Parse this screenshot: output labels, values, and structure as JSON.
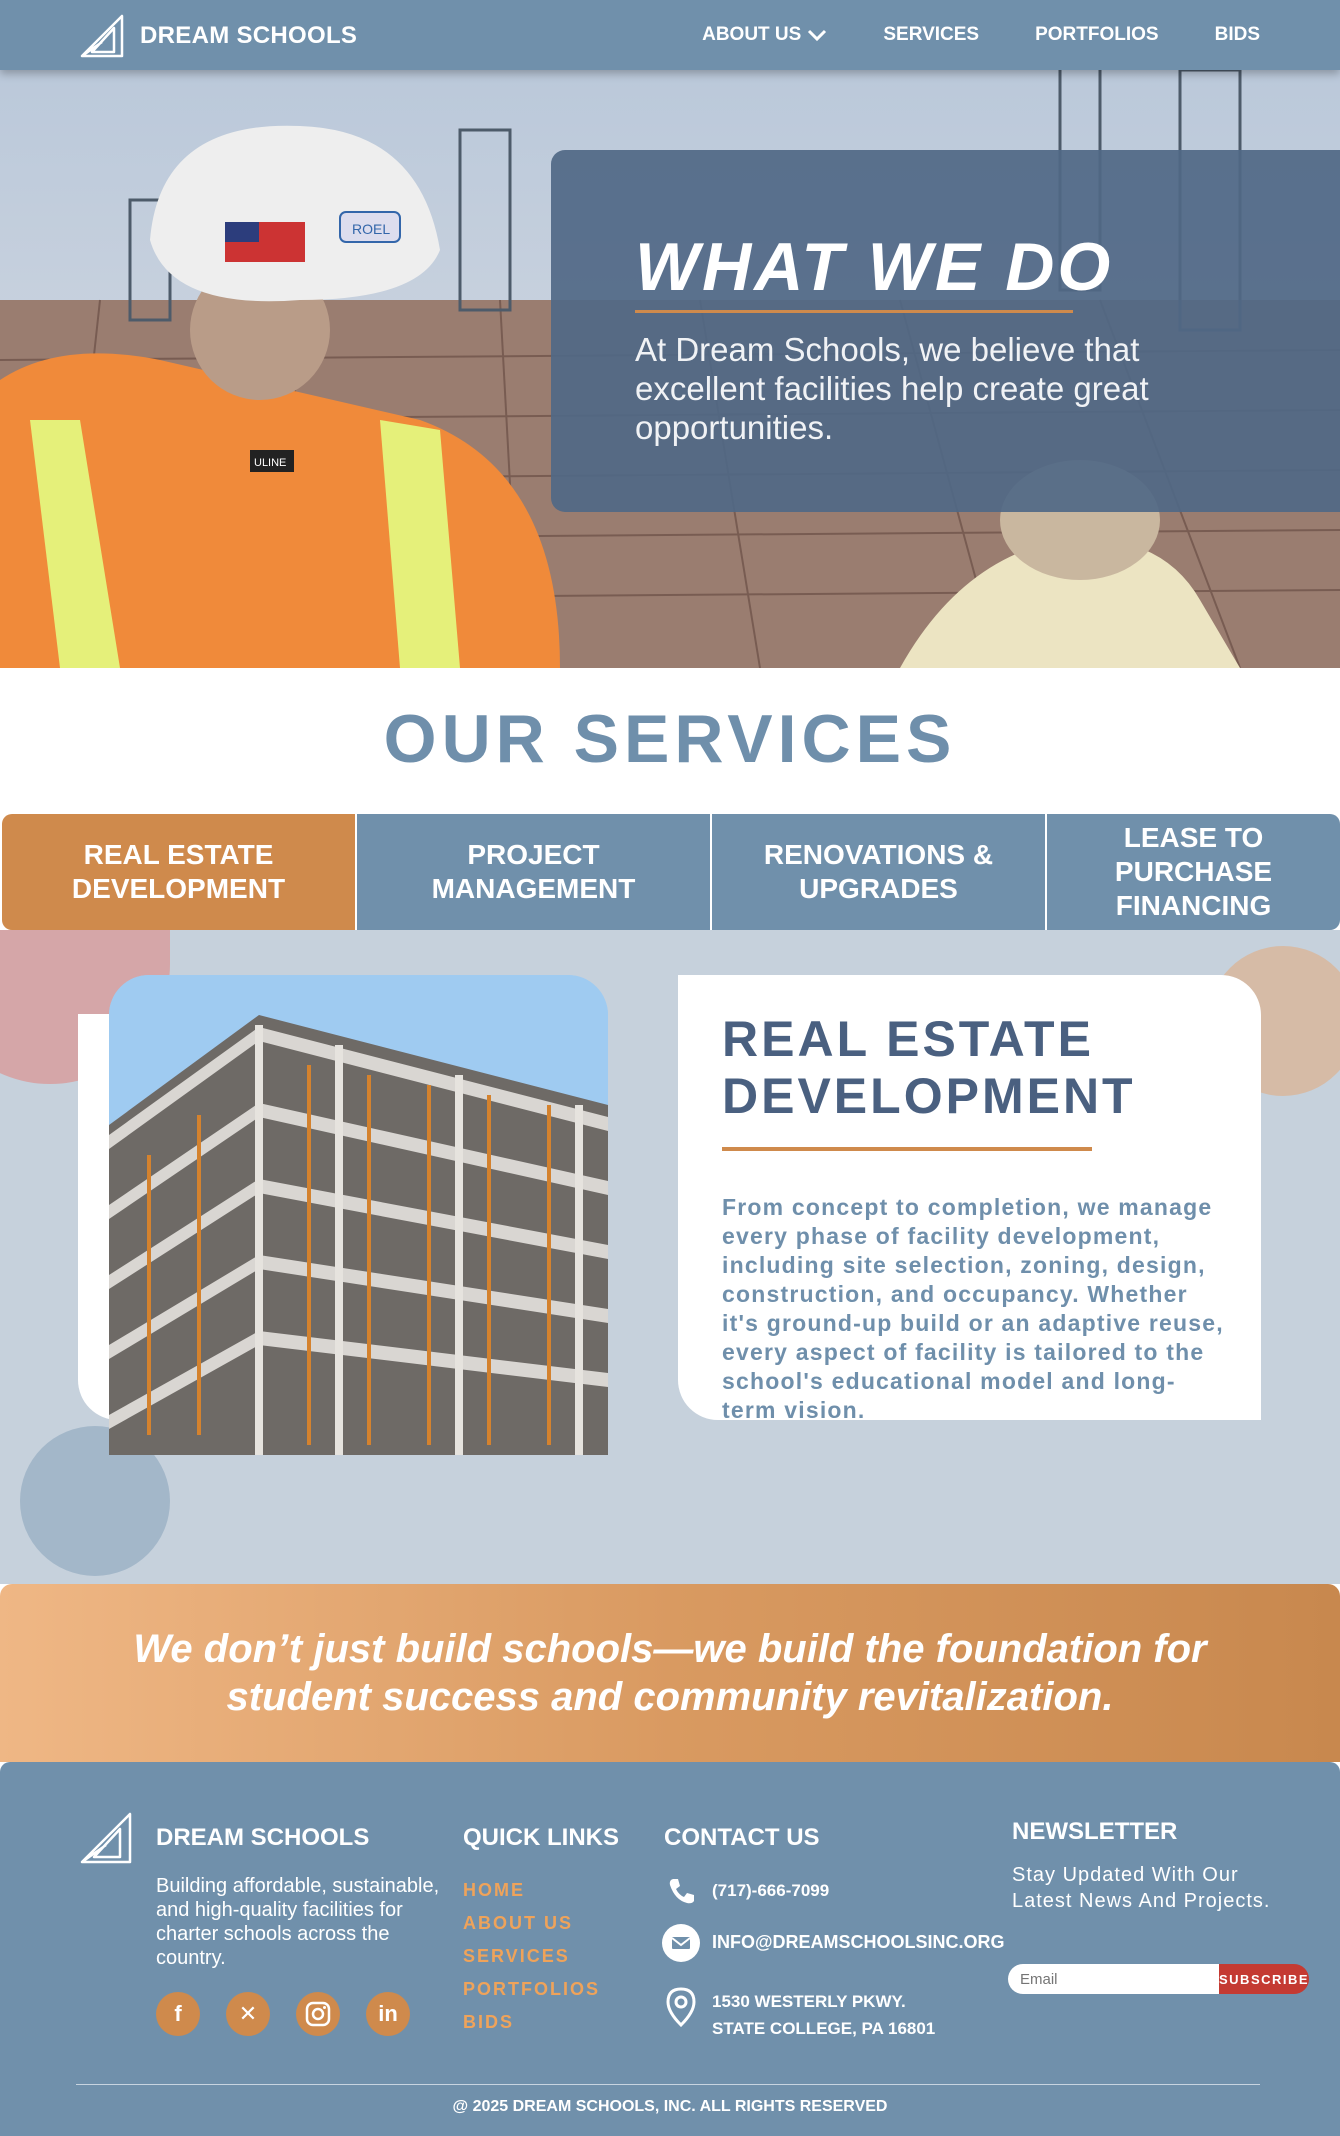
{
  "nav": {
    "brand": "DREAM SCHOOLS",
    "items": [
      {
        "label": "ABOUT US"
      },
      {
        "label": "SERVICES"
      },
      {
        "label": "PORTFOLIOS"
      },
      {
        "label": "BIDS"
      }
    ]
  },
  "hero": {
    "title": "WHAT WE DO",
    "text": "At Dream Schools, we believe that excellent facilities help create great opportunities.",
    "helmet_label": "ROEL",
    "vest_label": "ULINE"
  },
  "services": {
    "title": "OUR SERVICES",
    "tabs": [
      {
        "label": "REAL ESTATE DEVELOPMENT",
        "active": true
      },
      {
        "label": "PROJECT MANAGEMENT",
        "active": false
      },
      {
        "label": "RENOVATIONS & UPGRADES",
        "active": false
      },
      {
        "label": "LEASE TO PURCHASE FINANCING",
        "active": false
      }
    ],
    "active": {
      "title": "REAL ESTATE DEVELOPMENT",
      "text": "From concept to completion, we manage every phase of facility development, including site selection, zoning, design, construction, and occupancy. Whether it's ground-up build or an adaptive reuse, every aspect of facility is tailored to the school's educational model and long-term vision."
    }
  },
  "quote": {
    "text": "We don’t just build schools—we build the foundation for student success and community revitalization."
  },
  "footer": {
    "brand": "DREAM SCHOOLS",
    "tagline": "Building affordable, sustainable, and high-quality facilities for charter schools across the country.",
    "social": [
      {
        "icon": "facebook-icon",
        "glyph": "f"
      },
      {
        "icon": "x-twitter-icon",
        "glyph": "✕"
      },
      {
        "icon": "instagram-icon",
        "glyph": ""
      },
      {
        "icon": "linkedin-icon",
        "glyph": "in"
      }
    ],
    "quick_links_heading": "QUICK LINKS",
    "quick_links": [
      "HOME",
      "ABOUT US",
      "SERVICES",
      "PORTFOLIOS",
      "BIDS"
    ],
    "contact_heading": "CONTACT US",
    "phone": "(717)-666-7099",
    "email": "INFO@DREAMSCHOOLSINC.ORG",
    "address_line1": "1530 WESTERLY PKWY.",
    "address_line2": "STATE COLLEGE, PA 16801",
    "newsletter_heading": "NEWSLETTER",
    "newsletter_text": "Stay Updated With Our Latest News And Projects.",
    "email_placeholder": "Email",
    "subscribe_label": "SUBSCRIBE",
    "copyright": "@ 2025 DREAM SCHOOLS, INC. ALL RIGHTS RESERVED"
  },
  "colors": {
    "primary_blue": "#7090ab",
    "accent_orange": "#cf8a4c",
    "dark_slate": "#4a6080",
    "subscribe_red": "#c43a32"
  }
}
